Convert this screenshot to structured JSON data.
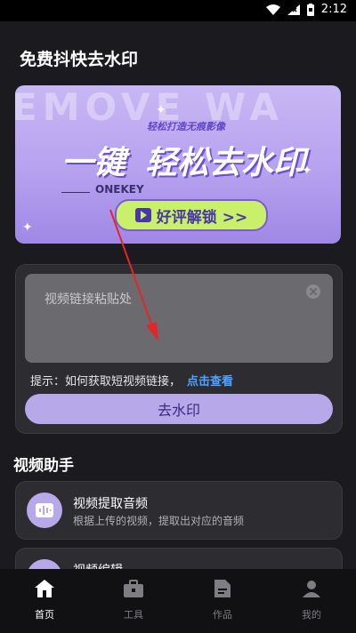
{
  "status": {
    "time": "2:12"
  },
  "page": {
    "title": "免费抖快去水印"
  },
  "banner": {
    "bg_text": "EMOVE WA",
    "subtitle": "轻松打造无痕影像",
    "big_left": "一键",
    "big_right": "轻松去水印",
    "onekey": "ONEKEY",
    "cta": "好评解锁 >>"
  },
  "input": {
    "placeholder": "视频链接粘贴处"
  },
  "hint": {
    "text": "提示：如何获取短视频链接，",
    "link": "点击查看"
  },
  "action": {
    "label": "去水印"
  },
  "section": {
    "title": "视频助手"
  },
  "cards": [
    {
      "title": "视频提取音频",
      "desc": "根据上传的视频，提取出对应的音频"
    },
    {
      "title": "视频编辑",
      "desc": ""
    }
  ],
  "tabs": [
    {
      "label": "首页",
      "icon": "home-icon"
    },
    {
      "label": "工具",
      "icon": "toolbox-icon"
    },
    {
      "label": "作品",
      "icon": "document-icon"
    },
    {
      "label": "我的",
      "icon": "user-icon"
    }
  ],
  "colors": {
    "accent": "#b7a8ea",
    "link": "#4fa3ff",
    "background": "#1b1b1f"
  }
}
